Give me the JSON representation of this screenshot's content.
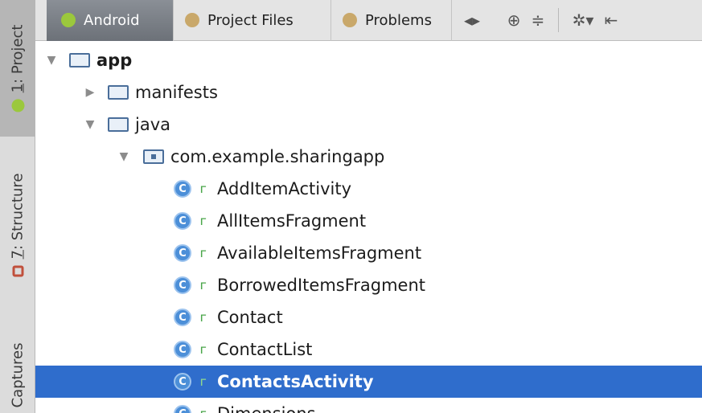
{
  "side_tabs": [
    {
      "prefix": "",
      "underlined": "1",
      "rest": ": Project"
    },
    {
      "prefix": "",
      "underlined": "7",
      "rest": ": Structure"
    },
    {
      "prefix": "",
      "underlined": "",
      "rest": "Captures"
    }
  ],
  "toolbar": {
    "tabs": [
      "Android",
      "Project Files",
      "Problems"
    ],
    "icons": [
      "collapse-expand-icon",
      "locate-icon",
      "collapse-all-icon",
      "settings-icon",
      "hide-icon"
    ]
  },
  "tree": {
    "root": "app",
    "manifests": "manifests",
    "java": "java",
    "package": "com.example.sharingapp",
    "class_glyph": "C",
    "lock_glyph": "ᴦ",
    "classes": [
      "AddItemActivity",
      "AllItemsFragment",
      "AvailableItemsFragment",
      "BorrowedItemsFragment",
      "Contact",
      "ContactList",
      "ContactsActivity",
      "Dimensions"
    ],
    "selected_index": 6
  },
  "colors": {
    "selection": "#2f6dcc",
    "active_tab": "#6c7178",
    "android_green": "#9bc83c"
  }
}
